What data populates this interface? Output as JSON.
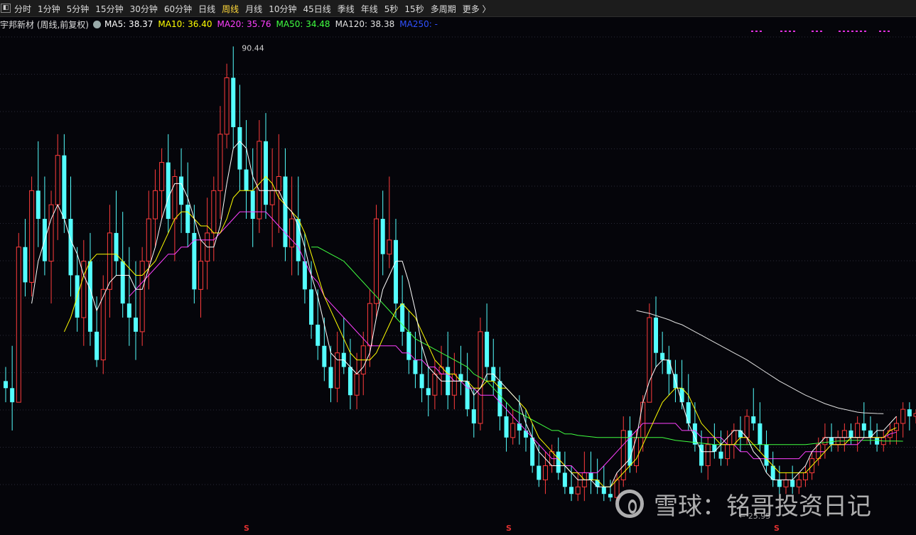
{
  "toolbar": {
    "icon": "panel-toggle-icon",
    "tabs": [
      {
        "label": "分时"
      },
      {
        "label": "1分钟"
      },
      {
        "label": "5分钟"
      },
      {
        "label": "15分钟"
      },
      {
        "label": "30分钟"
      },
      {
        "label": "60分钟"
      },
      {
        "label": "日线"
      },
      {
        "label": "周线",
        "active": true
      },
      {
        "label": "月线"
      },
      {
        "label": "10分钟"
      },
      {
        "label": "45日线"
      },
      {
        "label": "季线"
      },
      {
        "label": "年线"
      },
      {
        "label": "5秒"
      },
      {
        "label": "15秒"
      },
      {
        "label": "多周期"
      },
      {
        "label": "更多 〉"
      }
    ]
  },
  "legend": {
    "stock_name": "宇邦新材 (周线,前复权)",
    "ma5": "MA5: 38.37",
    "ma10": "MA10: 36.40",
    "ma20": "MA20: 35.76",
    "ma50": "MA50: 34.48",
    "ma120": "MA120: 38.38",
    "ma250": "MA250: -",
    "colors": {
      "ma5": "#ffffff",
      "ma10": "#ffff00",
      "ma20": "#ff40ff",
      "ma50": "#40ff40",
      "ma120": "#e0e0e0",
      "ma250": "#3050ff"
    }
  },
  "annotations": {
    "high_label": "90.44",
    "low_label": "← 25.95"
  },
  "markers": [
    "S",
    "S",
    "S"
  ],
  "watermark": {
    "text": "雪球：铭哥投资日记"
  },
  "chart_data": {
    "type": "candlestick",
    "ylim": [
      24,
      93
    ],
    "up_color": "#ff3c3c",
    "down_color": "#54ffff",
    "candles": [
      [
        43,
        45,
        40,
        42
      ],
      [
        42,
        48,
        36,
        40
      ],
      [
        40,
        64,
        40,
        62
      ],
      [
        62,
        66,
        55,
        57
      ],
      [
        57,
        72,
        55,
        70
      ],
      [
        70,
        77,
        62,
        66
      ],
      [
        66,
        72,
        58,
        60
      ],
      [
        60,
        70,
        54,
        68
      ],
      [
        68,
        78,
        63,
        75
      ],
      [
        75,
        78,
        64,
        66
      ],
      [
        66,
        72,
        55,
        58
      ],
      [
        58,
        62,
        50,
        52
      ],
      [
        52,
        63,
        48,
        60
      ],
      [
        60,
        64,
        48,
        50
      ],
      [
        50,
        55,
        45,
        46
      ],
      [
        46,
        58,
        44,
        56
      ],
      [
        56,
        68,
        52,
        64
      ],
      [
        64,
        70,
        58,
        60
      ],
      [
        60,
        67,
        52,
        54
      ],
      [
        54,
        62,
        48,
        52
      ],
      [
        52,
        60,
        46,
        50
      ],
      [
        50,
        62,
        48,
        60
      ],
      [
        60,
        70,
        56,
        66
      ],
      [
        66,
        73,
        62,
        70
      ],
      [
        70,
        76,
        66,
        74
      ],
      [
        74,
        78,
        64,
        66
      ],
      [
        66,
        73,
        60,
        72
      ],
      [
        72,
        76,
        64,
        68
      ],
      [
        68,
        74,
        62,
        64
      ],
      [
        64,
        68,
        54,
        56
      ],
      [
        56,
        63,
        52,
        60
      ],
      [
        60,
        69,
        56,
        64
      ],
      [
        64,
        72,
        60,
        70
      ],
      [
        70,
        82,
        66,
        78
      ],
      [
        78,
        88,
        76,
        86
      ],
      [
        86,
        90.44,
        76,
        79
      ],
      [
        79,
        85,
        70,
        73
      ],
      [
        73,
        80,
        66,
        70
      ],
      [
        70,
        76,
        62,
        66
      ],
      [
        66,
        80,
        64,
        77
      ],
      [
        77,
        81,
        66,
        68
      ],
      [
        68,
        76,
        62,
        70
      ],
      [
        70,
        78,
        64,
        72
      ],
      [
        72,
        76,
        60,
        62
      ],
      [
        62,
        72,
        58,
        66
      ],
      [
        66,
        72,
        58,
        60
      ],
      [
        60,
        64,
        54,
        56
      ],
      [
        56,
        60,
        49,
        51
      ],
      [
        51,
        56,
        46,
        48
      ],
      [
        48,
        52,
        43,
        45
      ],
      [
        45,
        48,
        40,
        42
      ],
      [
        42,
        50,
        40,
        47
      ],
      [
        47,
        52,
        44,
        45
      ],
      [
        45,
        49,
        39,
        41
      ],
      [
        41,
        47,
        39,
        44
      ],
      [
        44,
        50,
        41,
        48
      ],
      [
        48,
        56,
        45,
        54
      ],
      [
        54,
        68,
        52,
        66
      ],
      [
        66,
        70,
        58,
        61
      ],
      [
        61,
        72,
        59,
        63
      ],
      [
        63,
        66,
        52,
        54
      ],
      [
        54,
        58,
        48,
        50
      ],
      [
        50,
        53,
        44,
        46
      ],
      [
        46,
        50,
        42,
        44
      ],
      [
        44,
        48,
        40,
        42
      ],
      [
        42,
        45,
        38,
        41
      ],
      [
        41,
        46,
        39,
        44
      ],
      [
        44,
        48,
        41,
        45
      ],
      [
        45,
        50,
        39,
        41
      ],
      [
        41,
        47,
        39,
        44
      ],
      [
        44,
        48,
        41,
        43
      ],
      [
        43,
        47,
        38,
        39
      ],
      [
        39,
        42,
        35,
        37
      ],
      [
        37,
        52,
        36,
        50
      ],
      [
        50,
        54,
        43,
        45
      ],
      [
        45,
        49,
        41,
        43
      ],
      [
        43,
        45,
        36,
        38
      ],
      [
        38,
        40,
        33,
        35
      ],
      [
        35,
        39,
        34,
        37
      ],
      [
        37,
        41,
        34,
        36
      ],
      [
        36,
        39,
        33,
        35
      ],
      [
        35,
        37,
        30,
        31
      ],
      [
        31,
        34,
        28,
        29
      ],
      [
        29,
        33,
        27,
        31
      ],
      [
        31,
        34,
        30,
        33
      ],
      [
        33,
        35,
        29,
        30
      ],
      [
        30,
        33,
        27,
        28
      ],
      [
        28,
        31,
        26,
        27
      ],
      [
        27,
        30,
        26,
        28
      ],
      [
        28,
        33,
        26,
        30
      ],
      [
        30,
        33,
        27,
        29
      ],
      [
        29,
        32,
        27,
        28
      ],
      [
        28,
        31,
        26,
        27
      ],
      [
        27,
        29,
        25.95,
        26.5
      ],
      [
        26.5,
        30,
        26,
        29
      ],
      [
        29,
        38,
        28,
        36
      ],
      [
        36,
        38,
        30,
        31
      ],
      [
        31,
        36,
        30,
        35
      ],
      [
        35,
        41,
        33,
        40
      ],
      [
        40,
        54,
        40,
        52
      ],
      [
        52,
        55,
        45,
        47
      ],
      [
        47,
        50,
        44,
        46
      ],
      [
        46,
        48,
        41,
        44
      ],
      [
        44,
        46,
        40,
        42
      ],
      [
        42,
        46,
        39,
        40
      ],
      [
        40,
        44,
        36,
        37
      ],
      [
        37,
        40,
        33,
        34
      ],
      [
        34,
        36,
        30,
        31
      ],
      [
        31,
        35,
        29,
        34
      ],
      [
        34,
        37,
        32,
        33
      ],
      [
        33,
        36,
        31,
        32
      ],
      [
        32,
        36,
        31,
        34
      ],
      [
        34,
        37,
        32,
        36
      ],
      [
        36,
        38,
        33,
        35
      ],
      [
        35,
        39,
        34,
        38
      ],
      [
        38,
        42,
        36,
        37
      ],
      [
        37,
        40,
        33,
        34
      ],
      [
        34,
        36,
        30,
        31
      ],
      [
        31,
        33,
        28,
        29
      ],
      [
        29,
        31,
        27,
        28
      ],
      [
        28,
        30,
        27,
        29
      ],
      [
        29,
        31,
        27,
        28
      ],
      [
        28,
        30,
        27,
        29
      ],
      [
        29,
        31,
        28,
        30
      ],
      [
        30,
        33,
        29,
        32
      ],
      [
        32,
        35,
        31,
        34
      ],
      [
        34,
        37,
        32,
        35
      ],
      [
        35,
        37,
        33,
        34
      ],
      [
        34,
        36,
        33,
        35
      ],
      [
        35,
        37,
        33,
        36
      ],
      [
        36,
        37,
        34,
        35
      ],
      [
        35,
        38,
        33,
        37
      ],
      [
        37,
        40,
        35,
        36
      ],
      [
        36,
        38,
        34,
        35
      ],
      [
        35,
        37,
        33,
        34
      ],
      [
        34,
        36,
        33,
        35
      ],
      [
        35,
        37,
        34,
        36
      ],
      [
        36,
        38,
        34,
        37
      ],
      [
        37,
        40,
        35,
        39
      ],
      [
        39,
        40,
        36,
        38
      ],
      [
        38,
        39,
        37,
        38.4
      ]
    ],
    "ma5_series": [
      null,
      null,
      null,
      null,
      54,
      60,
      63,
      66,
      68,
      66,
      63,
      61,
      58,
      56,
      53,
      55,
      57,
      58,
      58,
      58,
      56,
      56,
      59,
      62,
      66,
      69,
      71,
      71,
      69,
      66,
      63,
      62,
      62,
      65,
      71,
      76,
      77,
      76,
      72,
      70,
      70,
      70,
      70,
      68,
      67,
      65,
      62,
      58,
      55,
      51,
      47,
      46,
      46,
      45,
      44,
      45,
      47,
      52,
      56,
      58,
      60,
      60,
      57,
      53,
      48,
      45,
      44,
      43,
      43,
      43,
      43,
      43,
      41,
      42,
      44,
      44,
      43,
      42,
      41,
      40,
      37,
      35,
      33,
      32,
      31,
      31,
      31,
      30,
      29,
      29,
      29,
      28,
      28,
      28,
      30,
      31,
      32,
      35,
      40,
      43,
      45,
      46,
      46,
      43,
      40,
      37,
      35,
      33,
      33,
      33,
      34,
      35,
      36,
      36,
      35,
      33,
      32,
      30,
      29,
      29,
      29,
      29,
      30,
      31,
      33,
      34,
      35,
      35,
      35,
      35,
      35,
      35,
      35,
      35,
      36,
      36,
      37,
      38
    ],
    "ma10_series": [
      null,
      null,
      null,
      null,
      null,
      null,
      null,
      null,
      null,
      50,
      52,
      55,
      58,
      60,
      61,
      61,
      61,
      61,
      60,
      59,
      58,
      58,
      59,
      60,
      62,
      64,
      66,
      67,
      67,
      66,
      65,
      65,
      64,
      64,
      66,
      69,
      70,
      70,
      70,
      71,
      72,
      71,
      69,
      68,
      67,
      66,
      64,
      61,
      58,
      55,
      53,
      51,
      49,
      47,
      46,
      46,
      46,
      47,
      49,
      51,
      53,
      54,
      53,
      52,
      50,
      48,
      46,
      45,
      44,
      44,
      43,
      43,
      42,
      42,
      43,
      43,
      42,
      42,
      41,
      40,
      39,
      37,
      35,
      34,
      33,
      32,
      31,
      30,
      30,
      29,
      29,
      29,
      28,
      28,
      29,
      30,
      31,
      32,
      34,
      36,
      38,
      40,
      41,
      42,
      42,
      41,
      39,
      37,
      36,
      35,
      34,
      34,
      34,
      35,
      35,
      34,
      33,
      32,
      31,
      30,
      30,
      30,
      30,
      30,
      31,
      32,
      33,
      34,
      34,
      34,
      35,
      35,
      35,
      35,
      35,
      35,
      36,
      36.4
    ],
    "ma20_series": [
      null,
      null,
      null,
      null,
      null,
      null,
      null,
      null,
      null,
      null,
      null,
      null,
      null,
      null,
      null,
      null,
      null,
      null,
      null,
      55,
      56,
      57,
      58,
      59,
      60,
      61,
      61,
      62,
      62,
      63,
      63,
      63,
      63,
      64,
      65,
      66,
      67,
      67,
      67,
      67,
      67,
      66,
      65,
      64,
      63,
      62,
      60,
      58,
      57,
      55,
      54,
      53,
      52,
      51,
      50,
      49,
      48,
      48,
      48,
      48,
      48,
      47,
      47,
      46,
      46,
      45,
      45,
      44,
      44,
      43,
      43,
      42,
      42,
      41,
      41,
      41,
      40,
      39,
      38,
      37,
      36,
      35,
      34,
      33,
      32,
      32,
      31,
      31,
      30,
      30,
      30,
      30,
      31,
      32,
      33,
      34,
      35,
      36,
      37,
      37,
      37,
      37,
      37,
      37,
      36,
      36,
      36,
      35,
      35,
      35,
      35,
      34,
      34,
      33,
      33,
      32,
      32,
      32,
      32,
      32,
      32,
      32,
      32,
      33,
      33,
      33,
      33,
      34,
      34,
      34,
      34,
      34,
      35,
      35,
      35,
      35,
      35.5,
      35.76
    ],
    "ma50_series": [
      null,
      null,
      null,
      null,
      null,
      null,
      null,
      null,
      null,
      null,
      null,
      null,
      null,
      null,
      null,
      null,
      null,
      null,
      null,
      null,
      null,
      null,
      null,
      null,
      null,
      null,
      null,
      null,
      null,
      null,
      null,
      null,
      null,
      null,
      null,
      null,
      null,
      null,
      null,
      null,
      null,
      null,
      null,
      null,
      null,
      null,
      null,
      62,
      62,
      61.5,
      61,
      60.5,
      60,
      59,
      58,
      57,
      56,
      55,
      54,
      53,
      52,
      51,
      50,
      49,
      48.5,
      48,
      47.5,
      47,
      46.5,
      46,
      45.5,
      45,
      44,
      43.5,
      43,
      42,
      41,
      40,
      39,
      38.5,
      38,
      37.5,
      37,
      36.5,
      36,
      36,
      35.5,
      35.5,
      35.3,
      35.2,
      35.1,
      35,
      35,
      35,
      35,
      35,
      35,
      35,
      35,
      35,
      35,
      35,
      34.8,
      34.6,
      34.5,
      34.4,
      34.3,
      34.2,
      34.1,
      34,
      34,
      34,
      34,
      34,
      34,
      34,
      34,
      34,
      34,
      34,
      34,
      34,
      34,
      34,
      34.1,
      34.2,
      34.3,
      34.4,
      34.5,
      34.5,
      34.6,
      34.6,
      34.6,
      34.6,
      34.6,
      34.5,
      34.5,
      34.5,
      34.48
    ],
    "ma120_series": [
      null,
      null,
      null,
      null,
      null,
      null,
      null,
      null,
      null,
      null,
      null,
      null,
      null,
      null,
      null,
      null,
      null,
      null,
      null,
      null,
      null,
      null,
      null,
      null,
      null,
      null,
      null,
      null,
      null,
      null,
      null,
      null,
      null,
      null,
      null,
      null,
      null,
      null,
      null,
      null,
      null,
      null,
      null,
      null,
      null,
      null,
      null,
      null,
      null,
      null,
      null,
      null,
      null,
      null,
      null,
      null,
      null,
      null,
      null,
      null,
      null,
      null,
      null,
      null,
      null,
      null,
      null,
      null,
      null,
      null,
      null,
      null,
      null,
      null,
      null,
      null,
      null,
      null,
      null,
      null,
      null,
      null,
      null,
      null,
      null,
      null,
      null,
      null,
      null,
      null,
      null,
      null,
      null,
      null,
      null,
      null,
      null,
      53,
      52.8,
      52.6,
      52.3,
      52,
      51.7,
      51.3,
      51,
      50.5,
      50,
      49.5,
      49,
      48.5,
      48,
      47.5,
      47,
      46.5,
      46,
      45.4,
      44.8,
      44.2,
      43.6,
      43,
      42.5,
      42,
      41.5,
      41,
      40.6,
      40.2,
      39.8,
      39.5,
      39.2,
      39,
      38.8,
      38.6,
      38.5,
      38.45,
      38.4,
      38.38
    ]
  }
}
